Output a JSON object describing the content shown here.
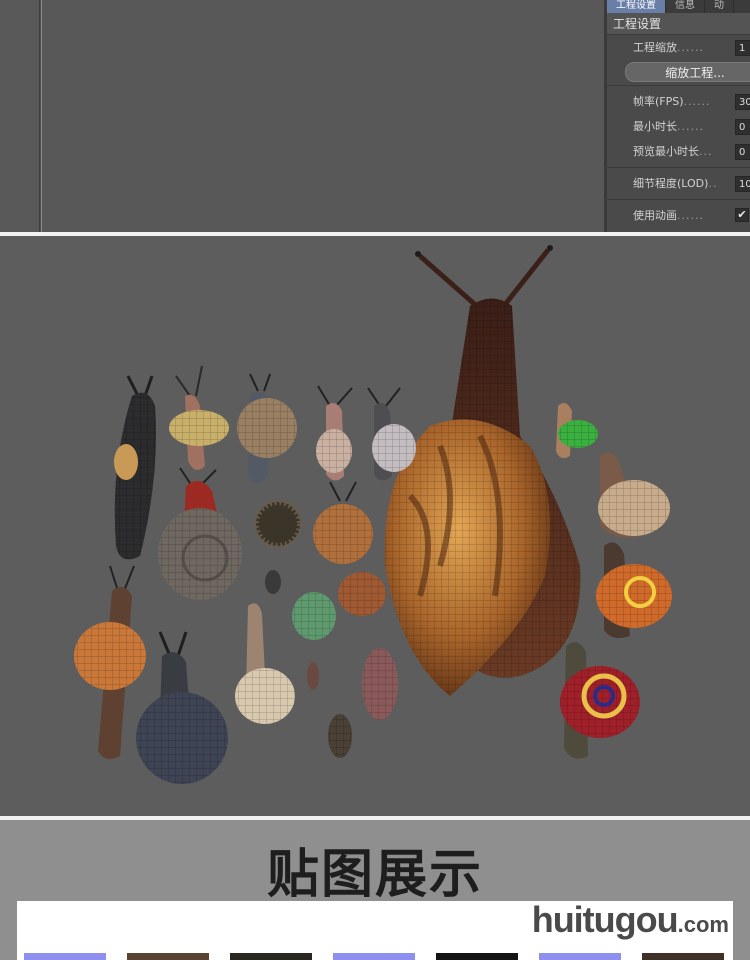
{
  "attribute_panel": {
    "tabs": [
      {
        "label": "工程设置",
        "active": true
      },
      {
        "label": "信息",
        "active": false
      },
      {
        "label": "动",
        "active": false
      }
    ],
    "section_title": "工程设置",
    "rows": [
      {
        "label": "工程缩放",
        "dots": "......",
        "value": "1"
      },
      {
        "label": "帧率(FPS)",
        "dots": "......",
        "value": "30"
      },
      {
        "label": "最小时长",
        "dots": "......",
        "value": "0"
      },
      {
        "label": "预览最小时长",
        "dots": "...",
        "value": "0"
      },
      {
        "label": "细节程度(LOD)",
        "dots": "..",
        "value": "10"
      },
      {
        "label": "使用动画",
        "dots": "......",
        "checked": true
      }
    ],
    "scale_button_label": "缩放工程..."
  },
  "showcase": {
    "title": "贴图展示",
    "brand_name": "huitugou",
    "brand_suffix": ".com",
    "thumb_colors": [
      "#8f8ff0",
      "#5a4232",
      "#2a2622",
      "#8f8ff0",
      "#141414",
      "#8f8ff0",
      "#3f3028"
    ]
  },
  "colors": {
    "panel_bg": "#4a4a4a",
    "viewport_bg": "#585858",
    "render_bg": "#5d5d5d",
    "active_tab": "#6a7fa8"
  }
}
